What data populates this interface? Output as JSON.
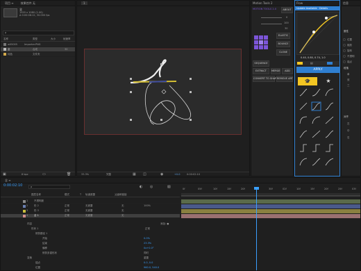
{
  "project": {
    "tab": "项目 ≡",
    "tab2": "效果控件 无",
    "item_name": "全",
    "item_size": "1920 x 1080 (1.00)",
    "item_dur": "Δ 0:00:08:12, 30.000 fps",
    "search_placeholder": "ρ",
    "cols": [
      "名称",
      "类型",
      "大小",
      "帧速率"
    ],
    "rows": [
      {
        "name": "w05005",
        "type": "Importer.PNG",
        "size": "",
        "fps": ""
      },
      {
        "name": "全",
        "type": "合成",
        "size": "",
        "fps": "30"
      },
      {
        "name": "纯色",
        "type": "文件夹",
        "size": "",
        "fps": ""
      }
    ],
    "bit": "8 bpc"
  },
  "viewer": {
    "zoom": "33.3%",
    "quality": "完整",
    "fps_badge": "+0.0",
    "time": "0:00:02:10",
    "tab": "1"
  },
  "motion_tools": {
    "title": "Motion Tools 2",
    "subtitle": "MOTION TOOLS 2.0",
    "about": "ABOUT",
    "val1": "0",
    "val2": "100",
    "val3": "30",
    "buttons": [
      "ELASTIC",
      "BOUNCE",
      "CLONE",
      "SEQUENCE",
      "MERGE",
      "EXTRACT",
      "ADD",
      "CONVERT TO SHAPE",
      "REMOVE ARTBOARD"
    ]
  },
  "flow": {
    "title": "Flow",
    "update_banner": "Update Available · Details",
    "values": "0.40, 0.80, 0.74, 1.0",
    "apply": "APPLY",
    "presets": [
      "Ease In",
      "Ease Out",
      "Bounce",
      "Linear",
      "In Out",
      "Quint",
      "Expo",
      "Circ",
      "Sine",
      "Back",
      "Elastic",
      "Steps",
      "Snap",
      "Hold",
      "Step In",
      "Custom",
      "Soft",
      "Sharp"
    ]
  },
  "right_panel": {
    "tab": "信息",
    "section1": "属性",
    "items1": [
      "位置",
      "缩放",
      "旋转",
      "不透明",
      "锚点"
    ],
    "section2": "段落",
    "items2": [
      "单",
      "双",
      "三"
    ],
    "section3": "对齐",
    "items3": [
      "左",
      "中",
      "右"
    ]
  },
  "timeline": {
    "tab": "全 ≡",
    "time": "0:00:02:10",
    "search_placeholder": "ρ",
    "cols": [
      "图层名称",
      "模式",
      "T",
      "轨道遮罩",
      "父级和链接"
    ],
    "layers": [
      {
        "num": "1",
        "name": "不透明度",
        "mode": "",
        "matte": "",
        "parent": "",
        "color": "#8a8a8a"
      },
      {
        "num": "2",
        "name": "形 2",
        "mode": "正常",
        "matte": "无遮罩",
        "parent": "无",
        "color": "#6a7fb0"
      },
      {
        "num": "3",
        "name": "形 3",
        "mode": "正常",
        "matte": "无遮罩",
        "parent": "无",
        "color": "#c8bd3c"
      },
      {
        "num": "4",
        "name": "全 1",
        "mode": "正常",
        "matte": "无遮罩",
        "parent": "无",
        "color": "#d08c8c"
      }
    ],
    "props": [
      {
        "name": "内容",
        "value": "添加: ●"
      },
      {
        "name": "形状 1",
        "value": "正常"
      },
      {
        "name": "修剪路径 1",
        "value": ""
      },
      {
        "name": "开始",
        "value": "0.0%"
      },
      {
        "name": "结束",
        "value": "23.3%"
      },
      {
        "name": "偏移",
        "value": "0x+0.0°"
      },
      {
        "name": "修剪多重形状",
        "value": "同时"
      },
      {
        "name": "变换",
        "value": "重置"
      },
      {
        "name": "锚点",
        "value": "0.0, 0.0"
      },
      {
        "name": "位置",
        "value": "960.0, 540.0"
      }
    ],
    "ruler": [
      "0f",
      "05f",
      "10f",
      "15f",
      "20f",
      "25f",
      "30f",
      "02f",
      "10f",
      "15f",
      "20f",
      "25f",
      "03f"
    ],
    "percent": "100%"
  },
  "colors": {
    "accent_blue": "#2f7fd1",
    "flow_yellow": "#f3c623",
    "mt_purple": "#7c55d8",
    "playhead": "#3aa0ff"
  }
}
